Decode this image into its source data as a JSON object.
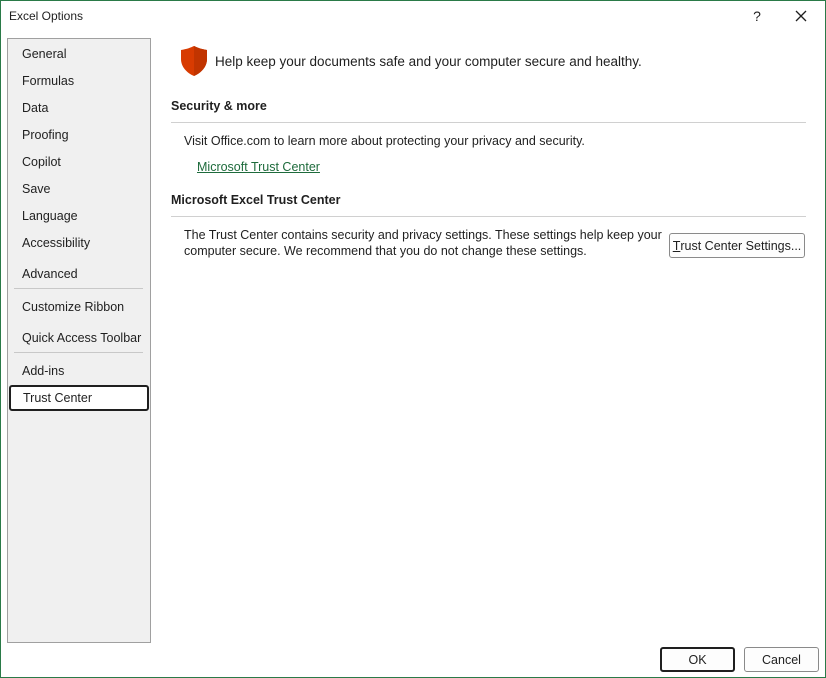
{
  "window": {
    "title": "Excel Options",
    "help_label": "?"
  },
  "sidebar": {
    "items": [
      {
        "label": "General"
      },
      {
        "label": "Formulas"
      },
      {
        "label": "Data"
      },
      {
        "label": "Proofing"
      },
      {
        "label": "Copilot"
      },
      {
        "label": "Save"
      },
      {
        "label": "Language"
      },
      {
        "label": "Accessibility"
      },
      {
        "label": "Advanced"
      },
      {
        "label": "Customize Ribbon"
      },
      {
        "label": "Quick Access Toolbar"
      },
      {
        "label": "Add-ins"
      },
      {
        "label": "Trust Center",
        "selected": true
      }
    ]
  },
  "main": {
    "header_text": "Help keep your documents safe and your computer secure and healthy.",
    "header_icon": "shield-icon",
    "accent_color": "#d83b01",
    "security": {
      "title": "Security & more",
      "text": "Visit Office.com to learn more about protecting your privacy and security.",
      "link": "Microsoft Trust Center"
    },
    "trust_center": {
      "title": "Microsoft Excel Trust Center",
      "text_line1": "The Trust Center contains security and privacy settings. These settings help keep your",
      "text_line2": "computer secure. We recommend that you do not change these settings.",
      "button_mnemonic": "T",
      "button_rest": "rust Center Settings..."
    }
  },
  "footer": {
    "ok_label": "OK",
    "cancel_label": "Cancel"
  }
}
